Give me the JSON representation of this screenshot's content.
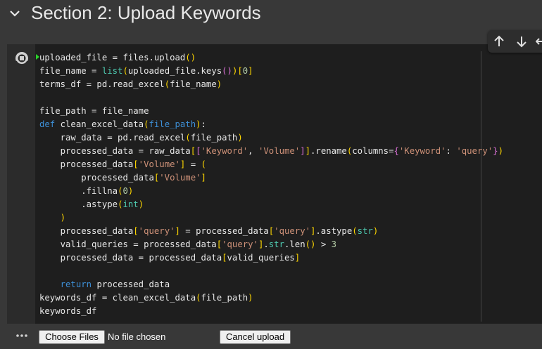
{
  "section": {
    "title": "Section 2: Upload Keywords",
    "collapse_icon": "chevron-down-icon"
  },
  "cell_toolbar": {
    "icons": [
      "arrow-up-icon",
      "arrow-down-icon",
      "link-icon"
    ]
  },
  "cell": {
    "run_icon": "running-stop-icon",
    "code_lines": [
      "uploaded_file = files.upload()",
      "file_name = list(uploaded_file.keys())[0]",
      "terms_df = pd.read_excel(file_name)",
      "",
      "file_path = file_name",
      "def clean_excel_data(file_path):",
      "    raw_data = pd.read_excel(file_path)",
      "    processed_data = raw_data[['Keyword', 'Volume']].rename(columns={'Keyword': 'query'})",
      "    processed_data['Volume'] = (",
      "        processed_data['Volume']",
      "        .fillna(0)",
      "        .astype(int)",
      "    )",
      "    processed_data['query'] = processed_data['query'].astype(str)",
      "    valid_queries = processed_data['query'].str.len() > 3",
      "    processed_data = processed_data[valid_queries]",
      "",
      "    return processed_data",
      "keywords_df = clean_excel_data(file_path)",
      "keywords_df"
    ]
  },
  "output": {
    "menu_icon": "more-horizontal-icon",
    "choose_files_label": "Choose Files",
    "file_status": "No file chosen",
    "cancel_upload_label": "Cancel upload"
  },
  "colors": {
    "background": "#383838",
    "code_background": "#1e1e1e",
    "keyword": "#3d8fd6",
    "builtin": "#4ec9b0",
    "string": "#ce9178",
    "number": "#b5cea8"
  }
}
